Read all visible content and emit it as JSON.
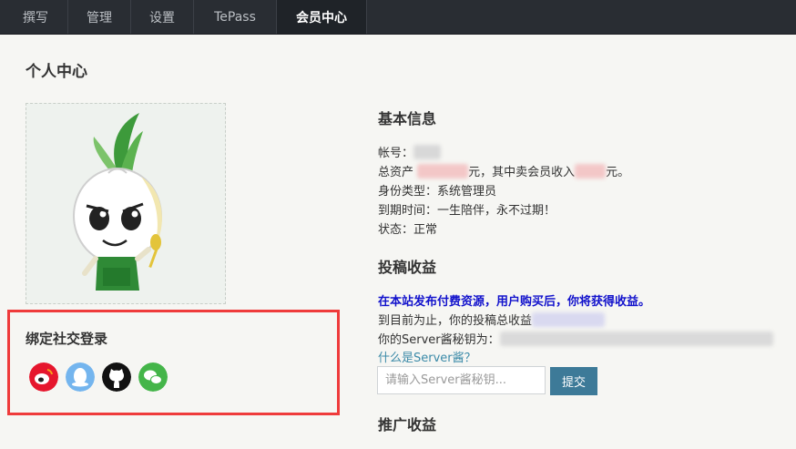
{
  "nav": {
    "tabs": [
      {
        "label": "撰写"
      },
      {
        "label": "管理"
      },
      {
        "label": "设置"
      },
      {
        "label": "TePass"
      },
      {
        "label": "会员中心",
        "active": true
      }
    ]
  },
  "page": {
    "title": "个人中心"
  },
  "avatar": {
    "icon": "onion-mascot-avatar"
  },
  "social": {
    "title": "绑定社交登录",
    "icons": [
      "weibo-icon",
      "qq-icon",
      "github-icon",
      "wechat-icon"
    ]
  },
  "basic_info": {
    "title": "基本信息",
    "account_label": "帐号：",
    "assets_label": "总资产",
    "assets_mid": "元，其中卖会员收入",
    "assets_end": "元。",
    "identity": "身份类型：系统管理员",
    "expire": "到期时间：一生陪伴，永不过期！",
    "status": "状态：正常"
  },
  "contrib": {
    "title": "投稿收益",
    "notice": "在本站发布付费资源，用户购买后，你将获得收益。",
    "total_label": "到目前为止，你的投稿总收益",
    "server_key_label": "你的Server酱秘钥为：",
    "what_link": "什么是Server酱？",
    "input_placeholder": "请输入Server酱秘钥...",
    "submit_label": "提交"
  },
  "promo": {
    "title": "推广收益"
  },
  "colors": {
    "nav_bg": "#292d33",
    "accent_red": "#ef3b3b",
    "button_blue": "#3d7a98",
    "notice_blue": "#1212cc",
    "link_blue": "#3b8aa8"
  }
}
